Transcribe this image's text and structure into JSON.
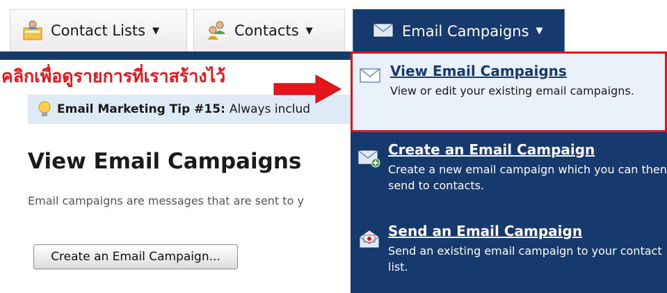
{
  "tabs": [
    {
      "label": "Contact Lists",
      "icon": "contact-lists-icon"
    },
    {
      "label": "Contacts",
      "icon": "contacts-icon"
    },
    {
      "label": "Email Campaigns",
      "icon": "envelope-icon",
      "active": true
    }
  ],
  "caret": "▼",
  "annotation": {
    "text": "คลิกเพื่อดูรายการที่เราสร้างไว้",
    "color": "#e4151b"
  },
  "tip": {
    "title": "Email Marketing Tip #15:",
    "text": "Always includ"
  },
  "page": {
    "title": "View Email Campaigns",
    "description": "Email campaigns are messages that are sent to y",
    "create_button": "Create an Email Campaign..."
  },
  "menu": {
    "items": [
      {
        "title": "View Email Campaigns",
        "description": "View or edit your existing email campaigns.",
        "icon": "envelope-icon",
        "highlighted": true
      },
      {
        "title": "Create an Email Campaign",
        "description": "Create a new email campaign which you can then send to contacts.",
        "icon": "new-envelope-icon"
      },
      {
        "title": "Send an Email Campaign",
        "description": "Send an existing email campaign to your contact list.",
        "icon": "send-envelope-icon"
      }
    ]
  },
  "colors": {
    "navy": "#163a6d",
    "highlight_border": "#d9161c",
    "tip_background": "#dfeaf7"
  }
}
